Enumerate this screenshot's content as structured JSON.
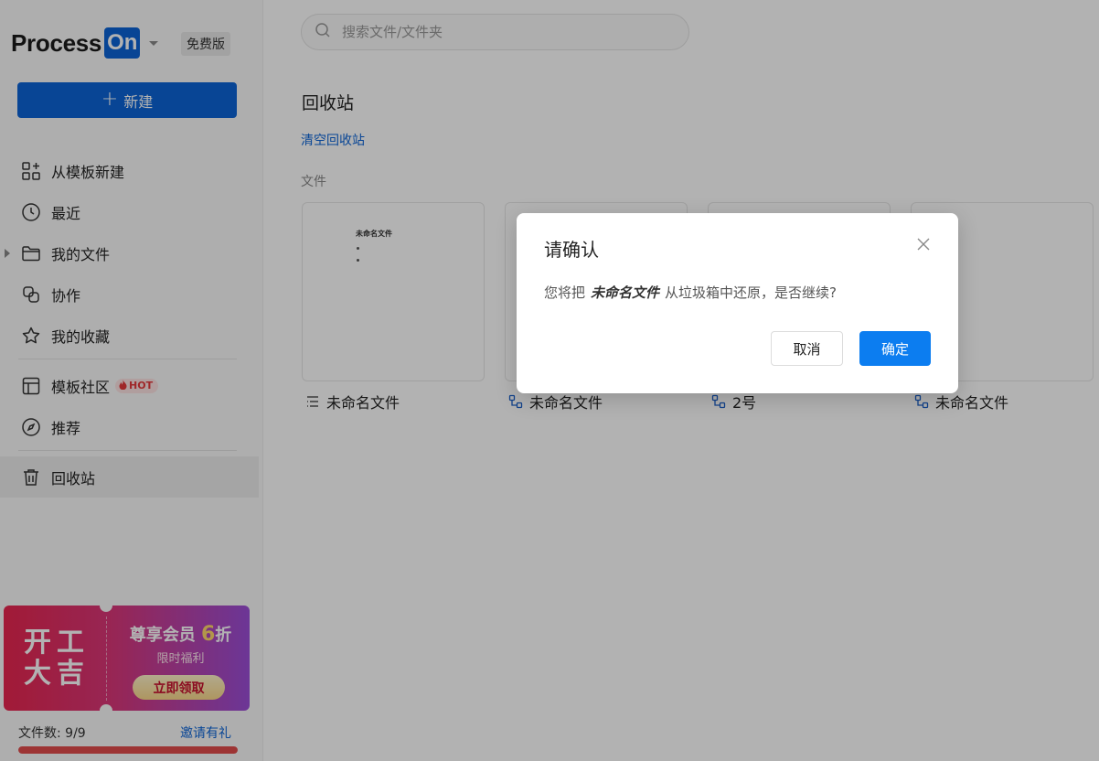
{
  "brand": {
    "name_prefix": "Process",
    "name_suffix": "On",
    "edition_badge": "免费版"
  },
  "sidebar": {
    "new_button": "新建",
    "nav": [
      {
        "label": "从模板新建",
        "icon": "template-grid-icon"
      },
      {
        "label": "最近",
        "icon": "clock-icon"
      },
      {
        "label": "我的文件",
        "icon": "folder-icon",
        "expandable": true
      },
      {
        "label": "协作",
        "icon": "collaborate-icon"
      },
      {
        "label": "我的收藏",
        "icon": "star-icon"
      },
      {
        "label": "模板社区",
        "icon": "layout-icon",
        "badge": "HOT"
      },
      {
        "label": "推荐",
        "icon": "compass-icon"
      },
      {
        "label": "回收站",
        "icon": "trash-icon",
        "active": true
      }
    ],
    "promo": {
      "left_text": "开工大吉",
      "title_prefix": "尊享会员",
      "title_number": "6",
      "title_suffix": "折",
      "subtitle": "限时福利",
      "button": "立即领取"
    },
    "quota": {
      "label": "文件数: 9/9",
      "used": 9,
      "total": 9,
      "invite_link": "邀请有礼"
    }
  },
  "main": {
    "search_placeholder": "搜索文件/文件夹",
    "page_title": "回收站",
    "empty_link": "清空回收站",
    "section_label": "文件",
    "files": [
      {
        "name": "未命名文件",
        "type": "mindmap",
        "type_icon": "outline-list-icon",
        "thumb_title": "未命名文件"
      },
      {
        "name": "未命名文件",
        "type": "flowchart",
        "type_icon": "flowchart-icon"
      },
      {
        "name": "2号",
        "type": "flowchart",
        "type_icon": "flowchart-icon"
      },
      {
        "name": "未命名文件",
        "type": "flowchart",
        "type_icon": "flowchart-icon"
      }
    ]
  },
  "dialog": {
    "title": "请确认",
    "message_prefix": "您将把",
    "file_name": "未命名文件",
    "message_suffix": "从垃圾箱中还原，是否继续?",
    "cancel": "取消",
    "confirm": "确定"
  },
  "colors": {
    "brand_blue": "#0c64d6",
    "confirm_blue": "#0c7df0",
    "quota_red": "#e14b4b",
    "hot_red": "#e4393c"
  }
}
